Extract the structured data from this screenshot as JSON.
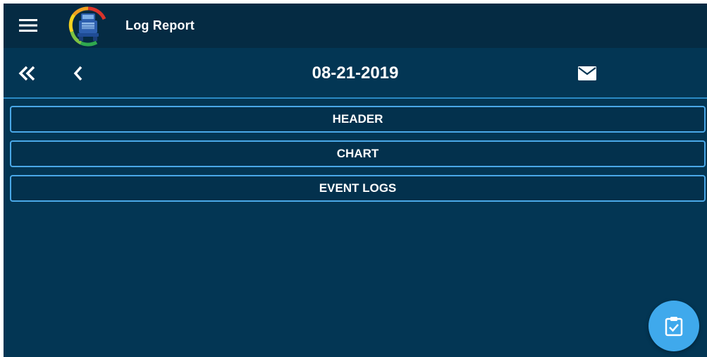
{
  "app": {
    "title": "Log Report"
  },
  "date_nav": {
    "date": "08-21-2019"
  },
  "sections": [
    {
      "label": "HEADER"
    },
    {
      "label": "CHART"
    },
    {
      "label": "EVENT LOGS"
    }
  ],
  "icons": {
    "menu": "hamburger-icon",
    "logo": "truck-gauge-logo",
    "first": "double-chevron-left-icon",
    "prev": "chevron-left-icon",
    "email": "envelope-icon",
    "fab": "clipboard-check-icon"
  },
  "colors": {
    "background": "#033654",
    "topbar": "#052b43",
    "accent": "#4aa8e8",
    "fab": "#3fa9ec",
    "text": "#ffffff"
  }
}
